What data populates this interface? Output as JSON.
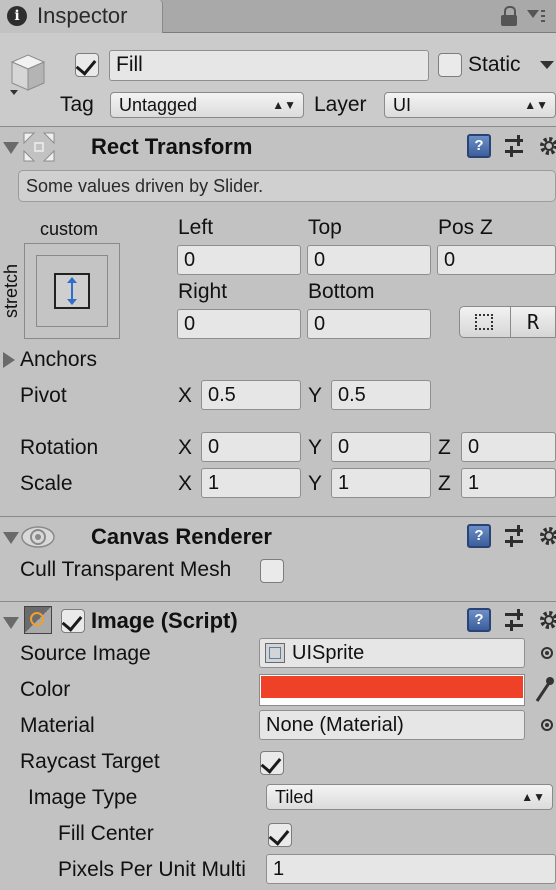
{
  "tab": {
    "icon": "info-icon",
    "title": "Inspector"
  },
  "gameobject": {
    "active": true,
    "name": "Fill",
    "static_label": "Static",
    "static": false,
    "tag_label": "Tag",
    "tag_value": "Untagged",
    "layer_label": "Layer",
    "layer_value": "UI"
  },
  "rect_transform": {
    "title": "Rect Transform",
    "info": "Some values driven by Slider.",
    "anchor_preset_top": "custom",
    "anchor_preset_side": "stretch",
    "left_label": "Left",
    "top_label": "Top",
    "posz_label": "Pos Z",
    "left": "0",
    "top": "0",
    "posz": "0",
    "right_label": "Right",
    "bottom_label": "Bottom",
    "right": "0",
    "bottom": "0",
    "raw_button": "R",
    "anchors_label": "Anchors",
    "pivot_label": "Pivot",
    "pivot_x": "0.5",
    "pivot_y": "0.5",
    "rotation_label": "Rotation",
    "rot_x": "0",
    "rot_y": "0",
    "rot_z": "0",
    "scale_label": "Scale",
    "scale_x": "1",
    "scale_y": "1",
    "scale_z": "1",
    "x": "X",
    "y": "Y",
    "z": "Z"
  },
  "canvas_renderer": {
    "title": "Canvas Renderer",
    "cull_label": "Cull Transparent Mesh",
    "cull": false
  },
  "image": {
    "title": "Image (Script)",
    "enabled": true,
    "source_label": "Source Image",
    "source_value": "UISprite",
    "color_label": "Color",
    "color_value": "#ee4128",
    "material_label": "Material",
    "material_value": "None (Material)",
    "raycast_label": "Raycast Target",
    "raycast": true,
    "type_label": "Image Type",
    "type_value": "Tiled",
    "fill_center_label": "Fill Center",
    "fill_center": true,
    "ppu_label": "Pixels Per Unit Multi",
    "ppu_value": "1"
  }
}
